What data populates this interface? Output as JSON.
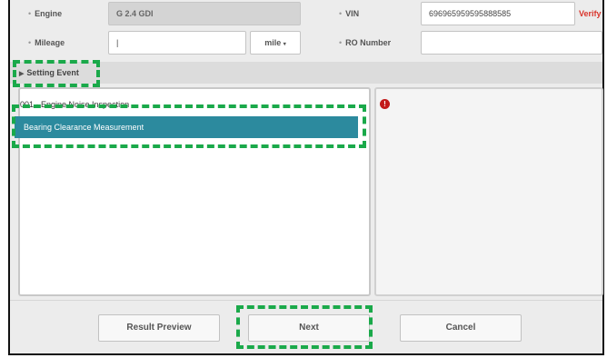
{
  "vehicle": {
    "engine_label": "Engine",
    "engine_value": "G 2.4 GDI",
    "vin_label": "VIN",
    "vin_value": "696965959595888585",
    "verify_label": "Verify",
    "mileage_label": "Mileage",
    "mileage_value": "|",
    "mileage_unit": "mile",
    "ro_label": "RO Number",
    "ro_value": ""
  },
  "setting_event": {
    "title": "Setting Event",
    "items": [
      {
        "label": "001 - Engine Noise Inspection",
        "selected": false
      },
      {
        "label": "Bearing Clearance Measurement",
        "selected": true
      }
    ]
  },
  "alert_icon": "!",
  "buttons": {
    "result_preview": "Result Preview",
    "next": "Next",
    "cancel": "Cancel"
  },
  "colors": {
    "selected_row": "#2c8a9e",
    "highlight": "#1aa94a",
    "alert": "#c21a1a",
    "verify": "#d9342b"
  }
}
